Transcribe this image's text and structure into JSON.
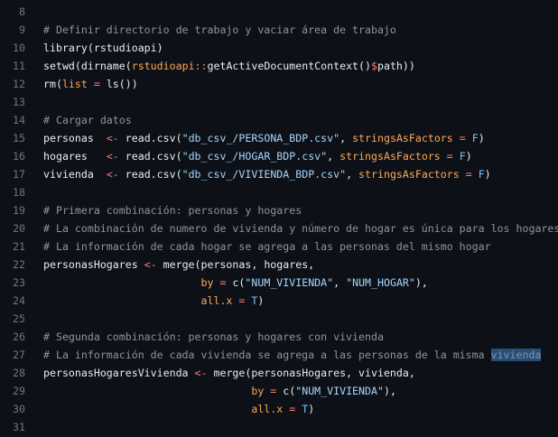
{
  "editor": {
    "lines": [
      {
        "n": "8",
        "tokens": []
      },
      {
        "n": "9",
        "tokens": [
          {
            "t": "# Definir directorio de trabajo y vaciar área de trabajo",
            "k": "comment"
          }
        ]
      },
      {
        "n": "10",
        "tokens": [
          {
            "t": "library(rstudioapi)",
            "k": "plain"
          }
        ]
      },
      {
        "n": "11",
        "tokens": [
          {
            "t": "setwd(dirname(",
            "k": "plain"
          },
          {
            "t": "rstudioapi",
            "k": "arg"
          },
          {
            "t": "::",
            "k": "op"
          },
          {
            "t": "getActiveDocumentContext()",
            "k": "plain"
          },
          {
            "t": "$",
            "k": "op"
          },
          {
            "t": "path))",
            "k": "plain"
          }
        ]
      },
      {
        "n": "12",
        "tokens": [
          {
            "t": "rm(",
            "k": "plain"
          },
          {
            "t": "list",
            "k": "arg"
          },
          {
            "t": " = ",
            "k": "op"
          },
          {
            "t": "ls())",
            "k": "plain"
          }
        ]
      },
      {
        "n": "13",
        "tokens": []
      },
      {
        "n": "14",
        "tokens": [
          {
            "t": "# Cargar datos",
            "k": "comment"
          }
        ]
      },
      {
        "n": "15",
        "tokens": [
          {
            "t": "personas  ",
            "k": "plain"
          },
          {
            "t": "<-",
            "k": "op"
          },
          {
            "t": " read.csv(",
            "k": "plain"
          },
          {
            "t": "\"db_csv_/PERSONA_BDP.csv\"",
            "k": "str"
          },
          {
            "t": ", ",
            "k": "plain"
          },
          {
            "t": "stringsAsFactors",
            "k": "arg"
          },
          {
            "t": " = ",
            "k": "op"
          },
          {
            "t": "F",
            "k": "const"
          },
          {
            "t": ")",
            "k": "plain"
          }
        ]
      },
      {
        "n": "16",
        "tokens": [
          {
            "t": "hogares   ",
            "k": "plain"
          },
          {
            "t": "<-",
            "k": "op"
          },
          {
            "t": " read.csv(",
            "k": "plain"
          },
          {
            "t": "\"db_csv_/HOGAR_BDP.csv\"",
            "k": "str"
          },
          {
            "t": ", ",
            "k": "plain"
          },
          {
            "t": "stringsAsFactors",
            "k": "arg"
          },
          {
            "t": " = ",
            "k": "op"
          },
          {
            "t": "F",
            "k": "const"
          },
          {
            "t": ")",
            "k": "plain"
          }
        ]
      },
      {
        "n": "17",
        "tokens": [
          {
            "t": "vivienda  ",
            "k": "plain"
          },
          {
            "t": "<-",
            "k": "op"
          },
          {
            "t": " read.csv(",
            "k": "plain"
          },
          {
            "t": "\"db_csv_/VIVIENDA_BDP.csv\"",
            "k": "str"
          },
          {
            "t": ", ",
            "k": "plain"
          },
          {
            "t": "stringsAsFactors",
            "k": "arg"
          },
          {
            "t": " = ",
            "k": "op"
          },
          {
            "t": "F",
            "k": "const"
          },
          {
            "t": ")",
            "k": "plain"
          }
        ]
      },
      {
        "n": "18",
        "tokens": []
      },
      {
        "n": "19",
        "tokens": [
          {
            "t": "# Primera combinación: personas y hogares",
            "k": "comment"
          }
        ]
      },
      {
        "n": "20",
        "tokens": [
          {
            "t": "# La combinación de numero de vivienda y número de hogar es única para los hogares",
            "k": "comment"
          }
        ]
      },
      {
        "n": "21",
        "tokens": [
          {
            "t": "# La información de cada hogar se agrega a las personas del mismo hogar",
            "k": "comment"
          }
        ]
      },
      {
        "n": "22",
        "tokens": [
          {
            "t": "personasHogares ",
            "k": "plain"
          },
          {
            "t": "<-",
            "k": "op"
          },
          {
            "t": " merge(personas, hogares,",
            "k": "plain"
          }
        ]
      },
      {
        "n": "23",
        "tokens": [
          {
            "t": "                         ",
            "k": "plain"
          },
          {
            "t": "by",
            "k": "arg"
          },
          {
            "t": " = ",
            "k": "op"
          },
          {
            "t": "c(",
            "k": "plain"
          },
          {
            "t": "\"NUM_VIVIENDA\"",
            "k": "str"
          },
          {
            "t": ", ",
            "k": "plain"
          },
          {
            "t": "\"NUM_HOGAR\"",
            "k": "str"
          },
          {
            "t": "),",
            "k": "plain"
          }
        ]
      },
      {
        "n": "24",
        "tokens": [
          {
            "t": "                         ",
            "k": "plain"
          },
          {
            "t": "all.x",
            "k": "arg"
          },
          {
            "t": " = ",
            "k": "op"
          },
          {
            "t": "T",
            "k": "const"
          },
          {
            "t": ")",
            "k": "plain"
          }
        ]
      },
      {
        "n": "25",
        "tokens": []
      },
      {
        "n": "26",
        "tokens": [
          {
            "t": "# Segunda combinación: personas y hogares con vivienda",
            "k": "comment"
          }
        ]
      },
      {
        "n": "27",
        "tokens": [
          {
            "t": "# La información de cada vivienda se agrega a las personas de la misma ",
            "k": "comment"
          },
          {
            "t": "vivienda",
            "k": "hl"
          }
        ]
      },
      {
        "n": "28",
        "tokens": [
          {
            "t": "personasHogaresVivienda ",
            "k": "plain"
          },
          {
            "t": "<-",
            "k": "op"
          },
          {
            "t": " merge(personasHogares, vivienda,",
            "k": "plain"
          }
        ]
      },
      {
        "n": "29",
        "tokens": [
          {
            "t": "                                 ",
            "k": "plain"
          },
          {
            "t": "by",
            "k": "arg"
          },
          {
            "t": " = ",
            "k": "op"
          },
          {
            "t": "c(",
            "k": "plain"
          },
          {
            "t": "\"NUM_VIVIENDA\"",
            "k": "str"
          },
          {
            "t": "),",
            "k": "plain"
          }
        ]
      },
      {
        "n": "30",
        "tokens": [
          {
            "t": "                                 ",
            "k": "plain"
          },
          {
            "t": "all.x",
            "k": "arg"
          },
          {
            "t": " = ",
            "k": "op"
          },
          {
            "t": "T",
            "k": "const"
          },
          {
            "t": ")",
            "k": "plain"
          }
        ]
      },
      {
        "n": "31",
        "tokens": []
      }
    ]
  }
}
